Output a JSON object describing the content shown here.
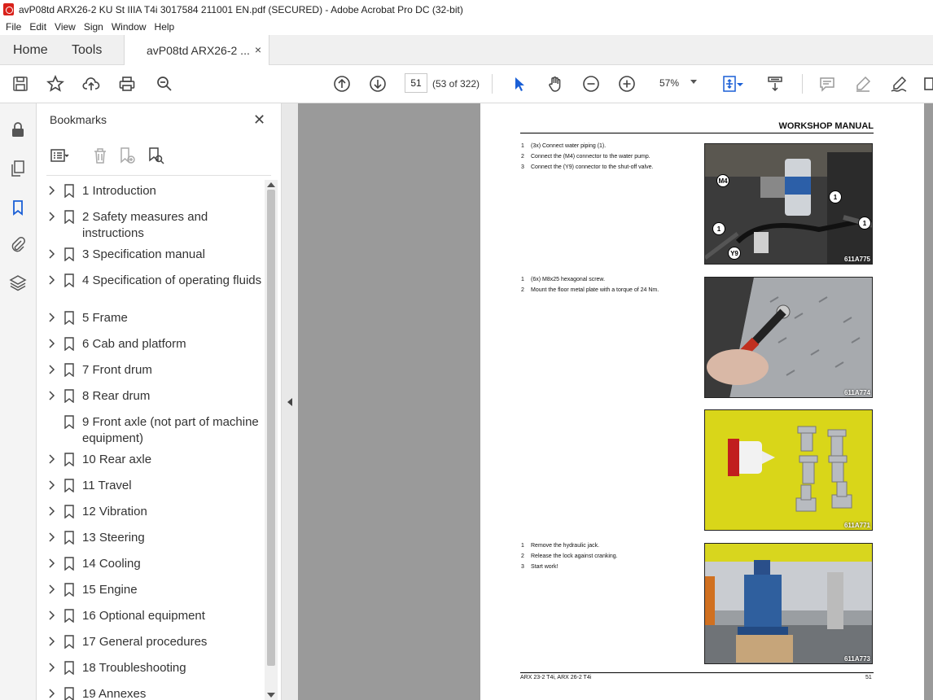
{
  "window": {
    "title": "avP08td ARX26-2 KU St IIIA T4i 3017584 211001 EN.pdf (SECURED) - Adobe Acrobat Pro DC (32-bit)"
  },
  "menu": [
    "File",
    "Edit",
    "View",
    "Sign",
    "Window",
    "Help"
  ],
  "tabs": {
    "home": "Home",
    "tools": "Tools",
    "document": "avP08td ARX26-2 ...",
    "close": "×"
  },
  "toolbar": {
    "page_number": "51",
    "page_count": "(53 of 322)",
    "zoom": "57%"
  },
  "bookmarks": {
    "title": "Bookmarks",
    "close": "✕",
    "items": [
      {
        "label": "1 Introduction",
        "expandable": true
      },
      {
        "label": "2 Safety measures and instructions",
        "expandable": true
      },
      {
        "label": "3 Specification manual",
        "expandable": true
      },
      {
        "label": "4 Specification of operating fluids",
        "expandable": true
      },
      {
        "label": "5 Frame",
        "expandable": true
      },
      {
        "label": "6 Cab and platform",
        "expandable": true
      },
      {
        "label": "7 Front drum",
        "expandable": true
      },
      {
        "label": "8 Rear drum",
        "expandable": true
      },
      {
        "label": "9 Front axle (not part of machine equipment)",
        "expandable": false
      },
      {
        "label": "10 Rear axle",
        "expandable": true
      },
      {
        "label": "11 Travel",
        "expandable": true
      },
      {
        "label": "12 Vibration",
        "expandable": true
      },
      {
        "label": "13 Steering",
        "expandable": true
      },
      {
        "label": "14 Cooling",
        "expandable": true
      },
      {
        "label": "15 Engine",
        "expandable": true
      },
      {
        "label": "16 Optional equipment",
        "expandable": true
      },
      {
        "label": "17 General procedures",
        "expandable": true
      },
      {
        "label": "18 Troubleshooting",
        "expandable": true
      },
      {
        "label": "19 Annexes",
        "expandable": true
      }
    ]
  },
  "page": {
    "header": "WORKSHOP MANUAL",
    "section1": [
      {
        "n": "1",
        "text": "(3x) Connect water piping (1)."
      },
      {
        "n": "2",
        "text": "Connect the (M4) connector to the water pump."
      },
      {
        "n": "3",
        "text": "Connect the (Y9) connector to the shut-off valve."
      }
    ],
    "section2": [
      {
        "n": "1",
        "text": "(6x) M8x25 hexagonal screw."
      },
      {
        "n": "2",
        "text": "Mount the floor metal plate with a torque of 24 Nm."
      }
    ],
    "section4": [
      {
        "n": "1",
        "text": "Remove the hydraulic jack."
      },
      {
        "n": "2",
        "text": "Release the lock against cranking."
      },
      {
        "n": "3",
        "text": "Start work!"
      }
    ],
    "photos": {
      "p1_code": "611A775",
      "p2_code": "611A774",
      "p3_code": "611A771",
      "p4_code": "611A773",
      "callout_m4": "M4",
      "callout_y9": "Y9",
      "callout_1": "1"
    },
    "footer_left": "ARX 23-2 T4i, ARX 26-2 T4i",
    "footer_right": "51"
  }
}
